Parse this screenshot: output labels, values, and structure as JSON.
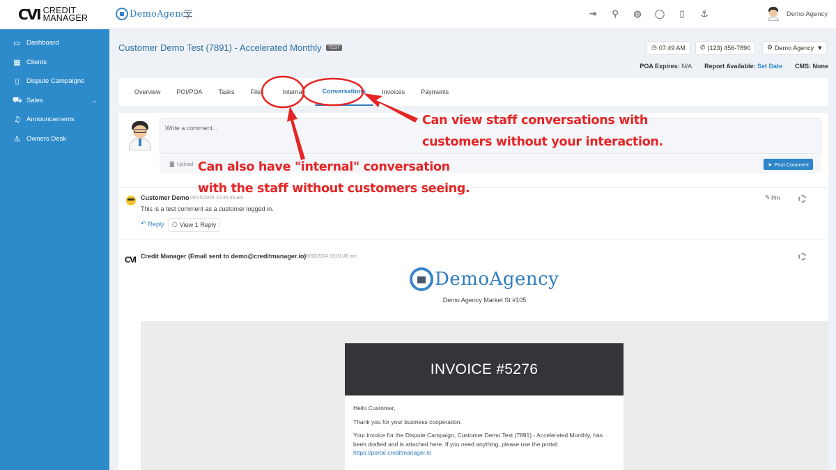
{
  "header": {
    "brand_mark": "CVI",
    "brand_line1": "CREDIT",
    "brand_line2": "MANAGER",
    "agency_name": "DemoAgency",
    "user_name": "Demo Agency",
    "icons": [
      "sign-out-icon",
      "search-icon",
      "globe-icon",
      "chat-icon",
      "document-add-icon",
      "anchor-icon"
    ]
  },
  "sidebar": {
    "items": [
      {
        "label": "Dashboard",
        "icon": "monitor-icon"
      },
      {
        "label": "Clients",
        "icon": "building-icon"
      },
      {
        "label": "Dispute Campaigns",
        "icon": "bookmark-icon"
      },
      {
        "label": "Sales",
        "icon": "cart-icon",
        "has_submenu": true
      },
      {
        "label": "Announcements",
        "icon": "bell-icon"
      },
      {
        "label": "Owners Desk",
        "icon": "anchor-icon"
      }
    ]
  },
  "page": {
    "title": "Customer Demo Test (7891) - Accelerated Monthly",
    "badge": "TEST",
    "time": "07:49 AM",
    "phone": "(123) 456-7890",
    "agency_select": "Demo Agency",
    "poa_label": "POA Expires:",
    "poa_value": "N/A",
    "report_label": "Report Available:",
    "report_value": "Set Date",
    "cms_label": "CMS:",
    "cms_value": "None"
  },
  "tabs": [
    "Overview",
    "POI/POA",
    "Tasks",
    "Files",
    "Internal",
    "Conversations",
    "Invoices",
    "Payments"
  ],
  "active_tab": "Conversations",
  "composer": {
    "placeholder": "Write a comment...",
    "upload_label": "Upload",
    "post_label": "Post Comment"
  },
  "comments": [
    {
      "author": "Customer Demo",
      "timestamp": "09/15/2024 10:45:45 am",
      "text": "This is a test comment as a customer logged in.",
      "reply_label": "Reply",
      "view_replies_label": "View 1 Reply",
      "pin_label": "Pin"
    },
    {
      "author": "Credit Manager (Email sent to demo@creditmanager.io)",
      "timestamp": "09/06/2024 03:01:49 am"
    }
  ],
  "email": {
    "logo_text": "DemoAgency",
    "address": "Demo Agency Market St #105",
    "invoice_title": "INVOICE #5276",
    "greeting": "Hello Customer,",
    "thanks": "Thank you for your business cooperation.",
    "body": "Your invoice for the Dispute Campaign, Customer Demo Test (7891) - Accelerated Monthly, has been drafted and is attached here. If you need anything, please use the portal:",
    "portal_link": "https://portal.creditmanager.io"
  },
  "annotations": {
    "color": "#e52525",
    "conversations_line1": "Can view staff conversations with",
    "conversations_line2": "customers without your interaction.",
    "internal_line1": "Can also have \"internal\" conversation",
    "internal_line2": "with the staff without customers seeing."
  }
}
